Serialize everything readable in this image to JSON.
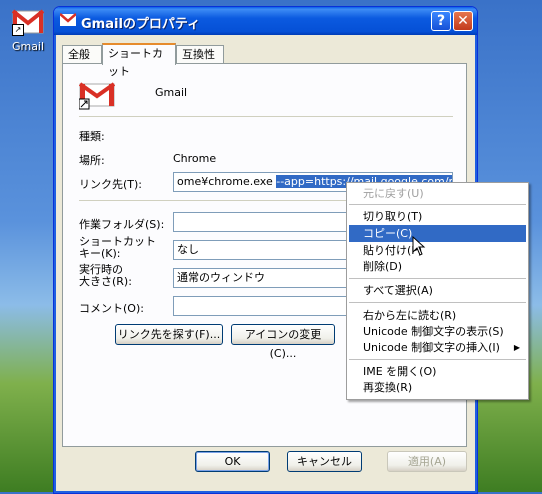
{
  "desktop": {
    "icon_label": "Gmail"
  },
  "window": {
    "title": "Gmailのプロパティ",
    "help_glyph": "?",
    "close_glyph": "✕"
  },
  "tabs": [
    "全般",
    "ショートカット",
    "互換性"
  ],
  "shortcut": {
    "name": "Gmail",
    "type_label": "種類:",
    "type_value": "",
    "location_label": "場所:",
    "location_value": "Chrome",
    "target_label": "リンク先(T):",
    "target_value_plain": "ome¥chrome.exe ",
    "target_value_selected": "--app=https://mail.google.com/mai",
    "startin_label": "作業フォルダ(S):",
    "startin_value": "",
    "hotkey_label_1": "ショートカット",
    "hotkey_label_2": "キー(K):",
    "hotkey_value": "なし",
    "run_label_1": "実行時の",
    "run_label_2": "大きさ(R):",
    "run_value": "通常のウィンドウ",
    "comment_label": "コメント(O):",
    "comment_value": "",
    "find_target_button": "リンク先を探す(F)...",
    "change_icon_button": "アイコンの変更(C)..."
  },
  "footer": {
    "ok": "OK",
    "cancel": "キャンセル",
    "apply": "適用(A)"
  },
  "context_menu": {
    "items": [
      {
        "label": "元に戻す(U)",
        "state": "disabled"
      },
      {
        "label": "切り取り(T)",
        "state": "normal"
      },
      {
        "label": "コピー(C)",
        "state": "highlighted"
      },
      {
        "label": "貼り付け(P)",
        "state": "normal"
      },
      {
        "label": "削除(D)",
        "state": "normal"
      },
      {
        "label": "すべて選択(A)",
        "state": "normal"
      },
      {
        "label": "右から左に読む(R)",
        "state": "normal"
      },
      {
        "label": "Unicode 制御文字の表示(S)",
        "state": "normal"
      },
      {
        "label": "Unicode 制御文字の挿入(I)",
        "state": "submenu"
      },
      {
        "label": "IME を開く(O)",
        "state": "normal"
      },
      {
        "label": "再変換(R)",
        "state": "normal"
      }
    ],
    "submenu_arrow": "▶"
  },
  "colors": {
    "selection": "#316ac5",
    "titlebar": "#0550d6",
    "gmail_red": "#d93025"
  }
}
